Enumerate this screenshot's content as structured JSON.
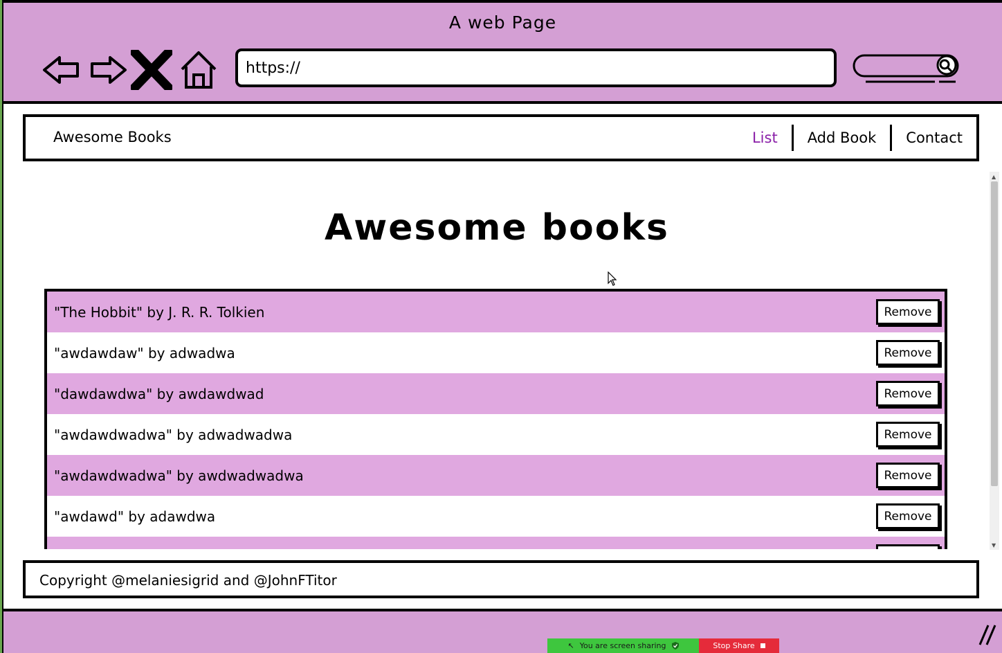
{
  "window": {
    "title": "A web Page"
  },
  "browser": {
    "url": "https://",
    "back_icon": "back-arrow-icon",
    "forward_icon": "forward-arrow-icon",
    "stop_icon": "close-x-icon",
    "home_icon": "home-icon",
    "search_icon": "magnifier-icon"
  },
  "nav": {
    "brand": "Awesome Books",
    "links": [
      {
        "label": "List",
        "active": true
      },
      {
        "label": "Add Book",
        "active": false
      },
      {
        "label": "Contact",
        "active": false
      }
    ]
  },
  "main": {
    "heading": "Awesome books",
    "remove_label": "Remove",
    "books": [
      {
        "text": "\"The Hobbit\" by J. R. R. Tolkien"
      },
      {
        "text": "\"awdawdaw\" by adwadwa"
      },
      {
        "text": "\"dawdawdwa\" by awdawdwad"
      },
      {
        "text": "\"awdawdwadwa\" by adwadwadwa"
      },
      {
        "text": "\"awdawdwadwa\" by awdwadwadwa"
      },
      {
        "text": "\"awdawd\" by adawdwa"
      },
      {
        "text": ""
      }
    ]
  },
  "footer": {
    "text": "Copyright @melaniesigrid and @JohnFTitor"
  },
  "screen_share": {
    "status": "You are screen sharing",
    "stop_label": "Stop Share"
  },
  "colors": {
    "chrome": "#d49fd4",
    "row_highlight": "#e0a8e0",
    "active_link": "#8a1fa8",
    "share_green": "#3ec63e",
    "share_red": "#e52b3a"
  }
}
